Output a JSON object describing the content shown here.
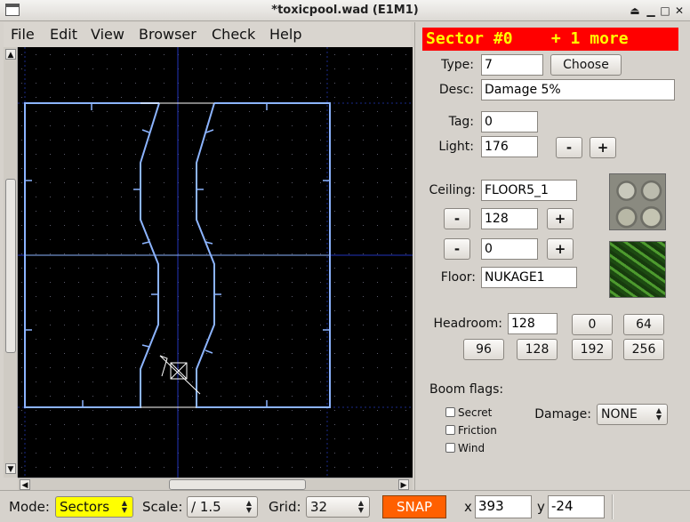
{
  "window": {
    "title": "*toxicpool.wad (E1M1)"
  },
  "menu": [
    "File",
    "Edit",
    "View",
    "Browser",
    "Check",
    "Help"
  ],
  "panel": {
    "header": "Sector #0    + 1 more",
    "type_label": "Type:",
    "type_value": "7",
    "choose_label": "Choose",
    "desc_label": "Desc:",
    "desc_value": "Damage 5%",
    "tag_label": "Tag:",
    "tag_value": "0",
    "light_label": "Light:",
    "light_value": "176",
    "minus": "-",
    "plus": "+",
    "ceiling_label": "Ceiling:",
    "ceiling_tex": "FLOOR5_1",
    "ceiling_height": "128",
    "floor_height": "0",
    "floor_label": "Floor:",
    "floor_tex": "NUKAGE1",
    "headroom_label": "Headroom:",
    "headroom_value": "128",
    "headroom_presets": [
      "0",
      "64",
      "96",
      "128",
      "192",
      "256"
    ],
    "boom_flags_label": "Boom flags:",
    "flags": [
      "Secret",
      "Friction",
      "Wind"
    ],
    "damage_label": "Damage:",
    "damage_value": "NONE"
  },
  "status": {
    "mode_label": "Mode:",
    "mode_value": "Sectors",
    "scale_label": "Scale:",
    "scale_value": "/ 1.5",
    "grid_label": "Grid:",
    "grid_value": "32",
    "snap_label": "SNAP",
    "x_label": "x",
    "x_value": "393",
    "y_label": "y",
    "y_value": "-24"
  },
  "colors": {
    "header_bg": "#ff0000",
    "header_fg": "#ffff00",
    "snap": "#ff6000",
    "mode": "#ffff00",
    "linedef": "#8cb4ff",
    "grid_major": "#2233aa"
  },
  "icons": {
    "ceiling_texture": "ceiling-texture-icon",
    "floor_texture": "floor-texture-icon"
  }
}
